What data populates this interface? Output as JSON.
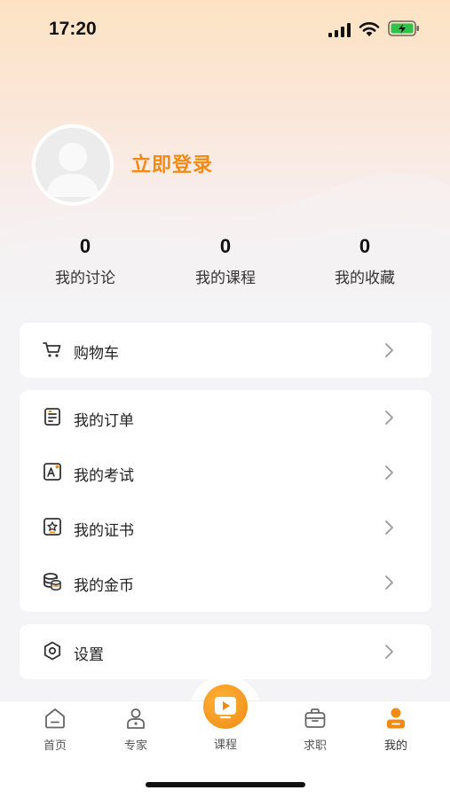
{
  "status_bar": {
    "time": "17:20"
  },
  "profile": {
    "login_label": "立即登录"
  },
  "stats": [
    {
      "count": "0",
      "label": "我的讨论"
    },
    {
      "count": "0",
      "label": "我的课程"
    },
    {
      "count": "0",
      "label": "我的收藏"
    }
  ],
  "menu": {
    "cart": {
      "label": "购物车",
      "icon": "cart-icon"
    },
    "orders": {
      "label": "我的订单",
      "icon": "order-icon"
    },
    "exams": {
      "label": "我的考试",
      "icon": "exam-icon"
    },
    "certificates": {
      "label": "我的证书",
      "icon": "certificate-icon"
    },
    "coins": {
      "label": "我的金币",
      "icon": "coins-icon"
    },
    "settings": {
      "label": "设置",
      "icon": "settings-icon"
    }
  },
  "tabbar": {
    "home": "首页",
    "experts": "专家",
    "courses": "课程",
    "jobs": "求职",
    "mine": "我的"
  },
  "colors": {
    "accent": "#f28a16",
    "text": "#222222",
    "background": "#f4f4f6"
  }
}
